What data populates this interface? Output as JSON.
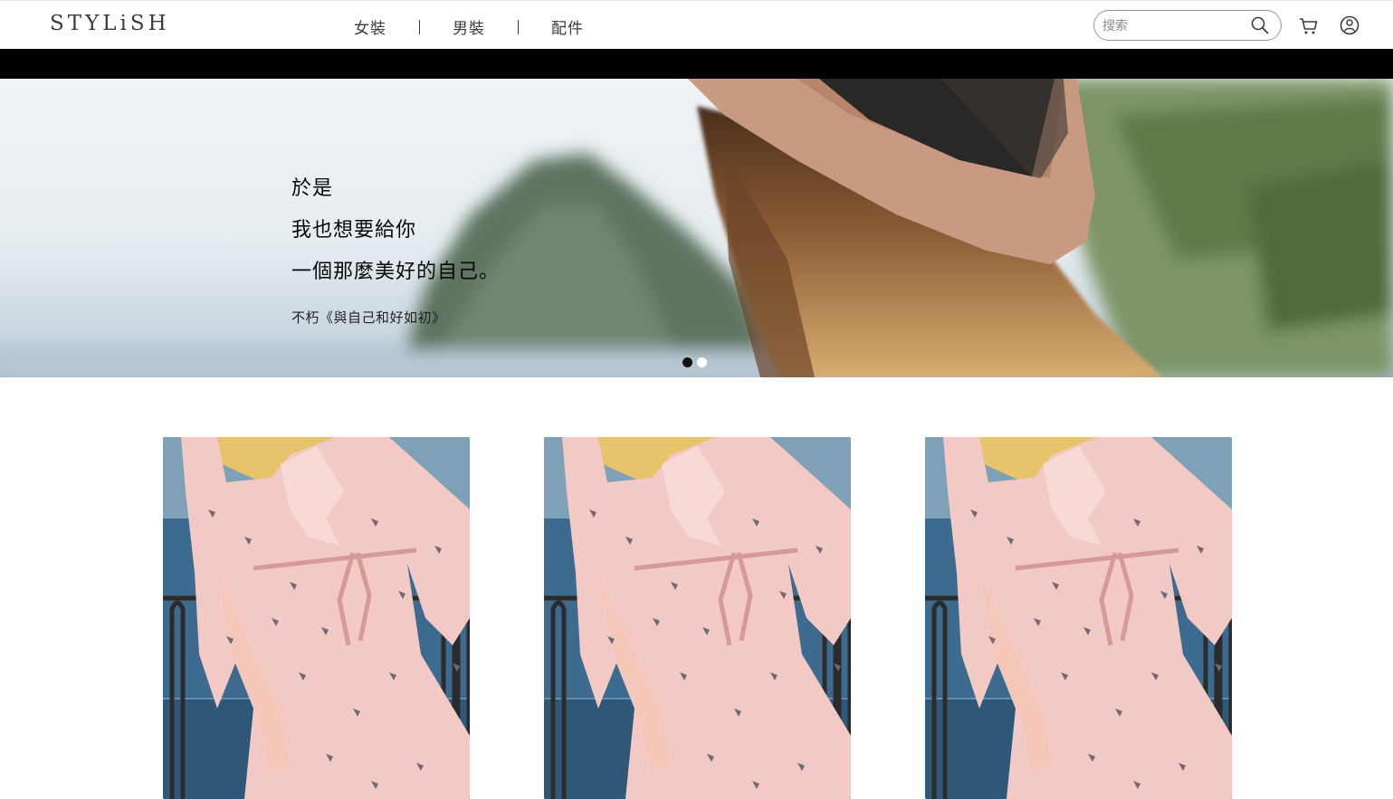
{
  "header": {
    "logo": "STYLiSH",
    "nav": [
      {
        "label": "女裝"
      },
      {
        "label": "男裝"
      },
      {
        "label": "配件"
      }
    ],
    "search": {
      "placeholder": "搜索",
      "value": ""
    }
  },
  "hero": {
    "lines": [
      "於是",
      "我也想要給你",
      "一個那麼美好的自己。"
    ],
    "source": "不朽《與自己和好如初》",
    "dots": {
      "count": 2,
      "active_index": 0
    }
  },
  "products": [
    {
      "image": "pink-bird-print-dress"
    },
    {
      "image": "pink-bird-print-dress"
    },
    {
      "image": "pink-bird-print-dress"
    }
  ],
  "colors": {
    "text": "#3f3a3a",
    "strip": "#000000",
    "dress": "#f2c9c4",
    "sea": "#3e6a8c",
    "hat": "#c99a82"
  }
}
